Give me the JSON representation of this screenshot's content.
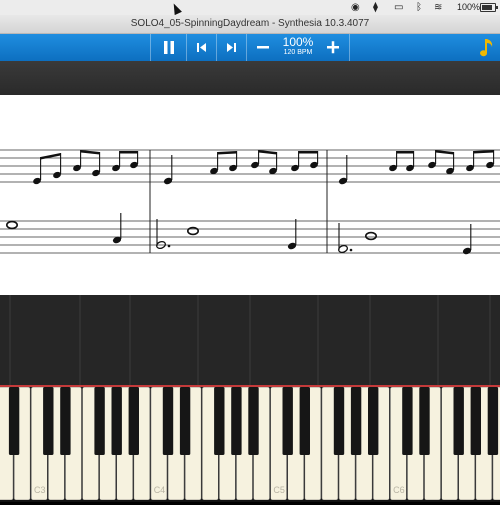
{
  "menubar": {
    "icons": [
      "record-icon",
      "dropbox-icon",
      "cast-icon",
      "bluetooth-icon",
      "wifi-icon",
      "battery-icon"
    ],
    "battery_percent": "100%"
  },
  "window": {
    "title": "SOLO4_05-SpinningDaydream - Synthesia 10.3.4077"
  },
  "toolbar": {
    "speed_percent": "100%",
    "tempo": "120 BPM",
    "pause_icon": "pause-icon",
    "prev_icon": "previous-icon",
    "next_icon": "next-icon",
    "minus_icon": "minus-icon",
    "plus_icon": "plus-icon",
    "music_icon": "music-note-icon",
    "accent": "#1a86d6"
  },
  "keyboard": {
    "octave_labels": [
      "C3",
      "C4",
      "C5",
      "C6"
    ],
    "top_line_color": "#c43a3a"
  }
}
